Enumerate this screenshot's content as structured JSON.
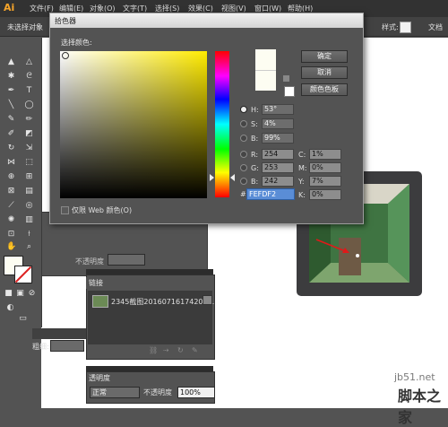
{
  "menubar": {
    "logo": "Ai",
    "items": [
      "文件(F)",
      "编辑(E)",
      "对象(O)",
      "文字(T)",
      "选择(S)",
      "效果(C)",
      "视图(V)",
      "窗口(W)",
      "帮助(H)"
    ]
  },
  "control_bar": {
    "selection_status": "未选择对象",
    "style_label": "样式:",
    "document_label": "文档"
  },
  "under_panel": {
    "opacity_label": "不透明度"
  },
  "stroke_panel": {
    "label": "粗细:"
  },
  "dialog": {
    "title": "拾色器",
    "pick_label": "选择颜色:",
    "web_only_label": "仅限 Web 颜色(O)",
    "buttons": {
      "ok": "确定",
      "cancel": "取消",
      "swatches": "颜色色板"
    },
    "fields": {
      "H": {
        "label": "H:",
        "value": "53°"
      },
      "S": {
        "label": "S:",
        "value": "4%"
      },
      "B": {
        "label": "B:",
        "value": "99%"
      },
      "R": {
        "label": "R:",
        "value": "254"
      },
      "G": {
        "label": "G:",
        "value": "253"
      },
      "Bl": {
        "label": "B:",
        "value": "242"
      },
      "C": {
        "label": "C:",
        "value": "1%"
      },
      "M": {
        "label": "M:",
        "value": "0%"
      },
      "Y": {
        "label": "Y:",
        "value": "7%"
      },
      "K": {
        "label": "K:",
        "value": "0%"
      }
    },
    "hex_value": "FEFDF2",
    "selected_color": "#fefdf2"
  },
  "links_panel": {
    "tab": "链接",
    "file_name": "2345截图20160716174207..."
  },
  "transparency_panel": {
    "tab": "透明度",
    "blend_mode": "正常",
    "opacity_label": "不透明度",
    "opacity_value": "100%"
  },
  "watermark": {
    "url": "jb51.net",
    "brand": "脚本之家"
  }
}
